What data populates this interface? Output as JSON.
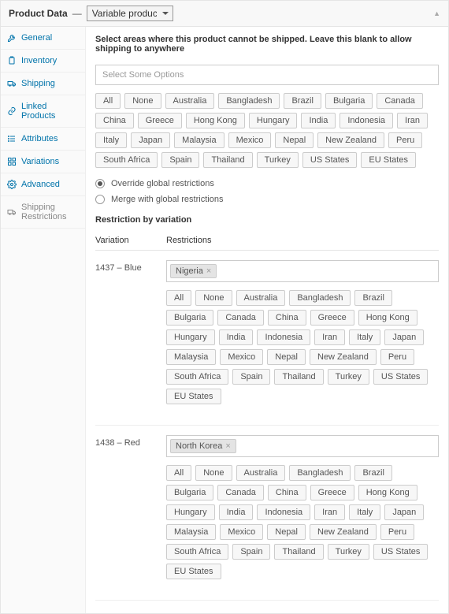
{
  "header": {
    "title": "Product Data",
    "sep": "—",
    "product_type": "Variable product"
  },
  "sidebar": {
    "items": [
      {
        "label": "General"
      },
      {
        "label": "Inventory"
      },
      {
        "label": "Shipping"
      },
      {
        "label": "Linked Products"
      },
      {
        "label": "Attributes"
      },
      {
        "label": "Variations"
      },
      {
        "label": "Advanced"
      },
      {
        "label": "Shipping Restrictions"
      }
    ]
  },
  "main": {
    "intro": "Select areas where this product cannot be shipped. Leave this blank to allow shipping to anywhere",
    "multiselect_placeholder": "Select Some Options",
    "locations": [
      "All",
      "None",
      "Australia",
      "Bangladesh",
      "Brazil",
      "Bulgaria",
      "Canada",
      "China",
      "Greece",
      "Hong Kong",
      "Hungary",
      "India",
      "Indonesia",
      "Iran",
      "Italy",
      "Japan",
      "Malaysia",
      "Mexico",
      "Nepal",
      "New Zealand",
      "Peru",
      "South Africa",
      "Spain",
      "Thailand",
      "Turkey",
      "US States",
      "EU States"
    ],
    "options": {
      "override": "Override global restrictions",
      "merge": "Merge with global restrictions",
      "selected": "override"
    },
    "variation_section_title": "Restriction by variation",
    "table": {
      "head_variation": "Variation",
      "head_restrictions": "Restrictions",
      "rows": [
        {
          "variation": "1437 – Blue",
          "tags": [
            "Nigeria"
          ]
        },
        {
          "variation": "1438 – Red",
          "tags": [
            "North Korea"
          ]
        }
      ]
    }
  }
}
